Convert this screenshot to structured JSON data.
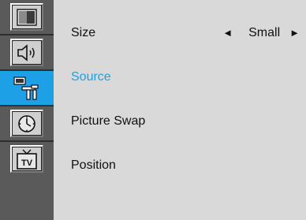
{
  "sidebar": {
    "items": [
      {
        "name": "picture-icon",
        "active": false
      },
      {
        "name": "sound-icon",
        "active": false
      },
      {
        "name": "setup-icon",
        "active": true
      },
      {
        "name": "clock-icon",
        "active": false
      },
      {
        "name": "tv-icon",
        "active": false
      }
    ],
    "tv_label": "TV"
  },
  "menu": {
    "rows": [
      {
        "label": "Size",
        "value": "Small",
        "left_arrow": "◄",
        "right_arrow": "►"
      },
      {
        "label": "Source"
      },
      {
        "label": "Picture Swap"
      },
      {
        "label": "Position"
      }
    ],
    "active_index": 1
  },
  "colors": {
    "accent": "#1ea0e6",
    "menu_background": "#d9d9d9",
    "sidebar_background": "#5a5a5a"
  }
}
